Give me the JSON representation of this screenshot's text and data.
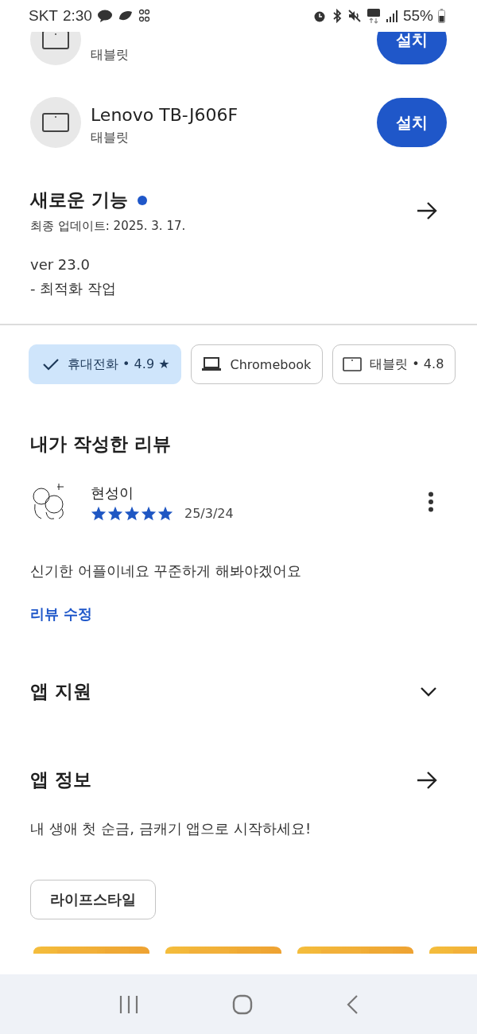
{
  "status_bar": {
    "carrier": "SKT",
    "time": "2:30",
    "battery": "55%"
  },
  "devices": [
    {
      "subtitle": "태블릿",
      "button": "설치"
    },
    {
      "name": "Lenovo TB-J606F",
      "subtitle": "태블릿",
      "button": "설치"
    }
  ],
  "whats_new": {
    "title": "새로운 기능",
    "unread": true,
    "updated": "최종 업데이트: 2025. 3. 17.",
    "lines": [
      "ver 23.0",
      "- 최적화 작업"
    ]
  },
  "device_chips": [
    {
      "label": "휴대전화 • 4.9 ★",
      "selected": true
    },
    {
      "kind": "laptop",
      "label": "Chromebook",
      "selected": false
    },
    {
      "kind": "tablet",
      "label": "태블릿 • 4.8",
      "selected": false
    }
  ],
  "my_review": {
    "title": "내가 작성한 리뷰",
    "author": "현성이",
    "stars": 5,
    "date": "25/3/24",
    "text": "신기한 어플이네요 꾸준하게 해봐야겠어요",
    "edit_link": "리뷰 수정"
  },
  "sections": [
    {
      "kind": "expand",
      "title": "앱 지원",
      "expanded": false
    },
    {
      "kind": "link",
      "title": "앱 정보"
    }
  ],
  "app_description": "내 생애 첫 순금, 금캐기 앱으로 시작하세요!",
  "category_tag": "라이프스타일"
}
